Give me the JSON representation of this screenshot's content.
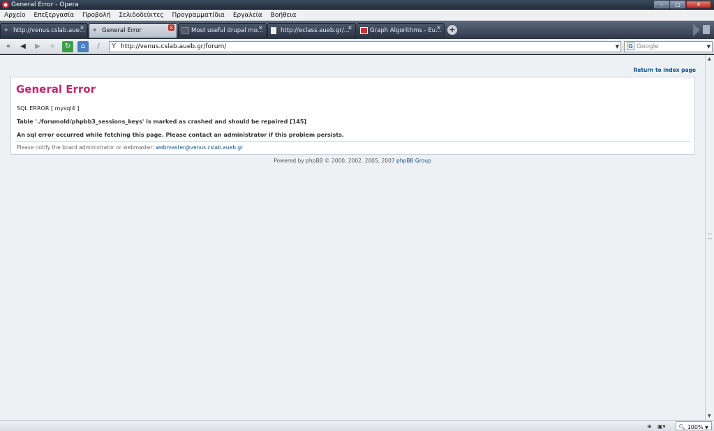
{
  "window": {
    "title": "General Error - Opera"
  },
  "menu": [
    "Αρχείο",
    "Επεξεργασία",
    "Προβολή",
    "Σελιδοδείκτες",
    "Προγραμματίδια",
    "Εργαλεία",
    "Βοήθεια"
  ],
  "tabs": [
    {
      "label": "http://venus.cslab.aue...",
      "active": false
    },
    {
      "label": "General Error",
      "active": true
    },
    {
      "label": "Most useful drupal mo...",
      "active": false
    },
    {
      "label": "http://eclass.aueb.gr/...",
      "active": false
    },
    {
      "label": "Graph Algorithms - Eu...",
      "active": false
    }
  ],
  "address": {
    "url": "http://venus.cslab.aueb.gr/forum/",
    "search_placeholder": "Google"
  },
  "page": {
    "return_link": "Return to index page",
    "heading": "General Error",
    "sql_error": "SQL ERROR [ mysql4 ]",
    "table_msg": "Table './forumold/phpbb3_sessions_keys' is marked as crashed and should be repaired [145]",
    "fetch_msg": "An sql error occurred while fetching this page. Please contact an administrator if this problem persists.",
    "notify_text": "Please notify the board administrator or webmaster:",
    "notify_email": "webmaster@venus.cslab.aueb.gr",
    "powered_text": "Powered by phpBB © 2000, 2002, 2005, 2007",
    "powered_link": "phpBB Group"
  },
  "status": {
    "zoom": "100%"
  }
}
